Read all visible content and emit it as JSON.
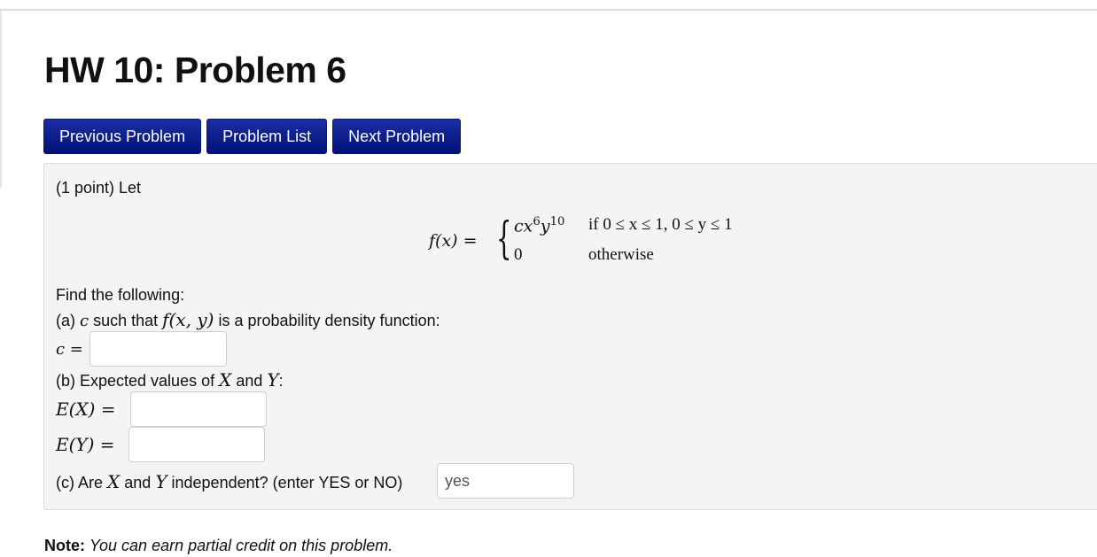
{
  "page": {
    "title": "HW 10: Problem 6"
  },
  "nav": {
    "previous_label": "Previous Problem",
    "list_label": "Problem List",
    "next_label": "Next Problem"
  },
  "problem": {
    "intro": "(1 point) Let",
    "formula": {
      "lhs": "f(x) =",
      "case1_expr_base": "cx",
      "case1_exp_x": "6",
      "case1_y": "y",
      "case1_exp_y": "10",
      "case1_cond": "if 0 ≤ x ≤ 1, 0 ≤ y ≤ 1",
      "case2_expr": "0",
      "case2_cond": "otherwise"
    },
    "find_label": "Find the following:",
    "part_a_prefix": "(a) ",
    "part_a_var": "c",
    "part_a_mid": " such that ",
    "part_a_fn": "f(x, y)",
    "part_a_suffix": " is a probability density function:",
    "c_label": "c =",
    "c_value": "",
    "part_b_prefix": "(b) Expected values of ",
    "part_b_x": "X",
    "part_b_and": " and ",
    "part_b_y": "Y",
    "part_b_suffix": ":",
    "ex_label": "E(X) =",
    "ex_value": "",
    "ey_label": "E(Y) =",
    "ey_value": "",
    "part_c_prefix": "(c) Are ",
    "part_c_x": "X",
    "part_c_and": " and ",
    "part_c_y": "Y",
    "part_c_suffix": " independent? (enter YES or NO)",
    "independent_value": "yes"
  },
  "note": {
    "bold": "Note:",
    "text": "You can earn partial credit on this problem."
  }
}
